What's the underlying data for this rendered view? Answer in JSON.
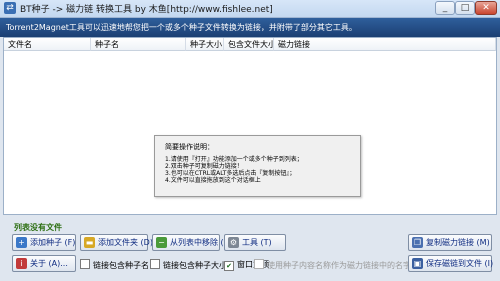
{
  "window": {
    "title": "BT种子 -> 磁力链 转换工具 by 木鱼[http://www.fishlee.net]",
    "minimize_label": "_",
    "maximize_label": "□",
    "close_label": "✕"
  },
  "banner": {
    "text": "Torrent2Magnet工具可以迅速地帮您把一个或多个种子文件转换为链接，并附带了部分其它工具。"
  },
  "table": {
    "columns": [
      "文件名",
      "种子名",
      "种子大小",
      "包含文件大小",
      "磁力链接"
    ],
    "rows": []
  },
  "help_dialog": {
    "title": "简要操作说明：",
    "lines": [
      "1.请使用『打开』功能添加一个或多个种子到列表；",
      "2.双击种子可复制磁力链接！",
      "3.也可以在CTRL或ALT多选后点击『复制按钮』；",
      "4.文件可以直接拖放到这个对话框上"
    ]
  },
  "status": {
    "text": "列表没有文件"
  },
  "buttons": {
    "add_torrent": "添加种子 (F)",
    "add_folder": "添加文件夹 (D)",
    "remove_from_list": "从列表中移除 (R)",
    "tools": "工具 (T)",
    "copy_magnet": "复制磁力链接 (M)",
    "about": "关于 (A)...",
    "save_links": "保存磁链到文件 (I)"
  },
  "options": {
    "include_filename": {
      "label": "链接包含种子名",
      "checked": false
    },
    "include_size": {
      "label": "链接包含种子大小",
      "checked": false
    },
    "topmost": {
      "label": "窗口置顶",
      "checked": true
    },
    "use_inner_name": {
      "label": "使用种子内容名称作为磁力链接中的名字",
      "checked": false,
      "enabled": false
    }
  },
  "icons": {
    "app": "app-icon",
    "add": "add-icon",
    "folder": "folder-icon",
    "remove": "remove-icon",
    "tools": "gear-icon",
    "copy": "copy-icon",
    "about": "info-icon",
    "save": "save-icon"
  },
  "colors": {
    "banner": "#2a568f",
    "status_text": "#2b6e10",
    "button_text": "#0d2a80"
  }
}
